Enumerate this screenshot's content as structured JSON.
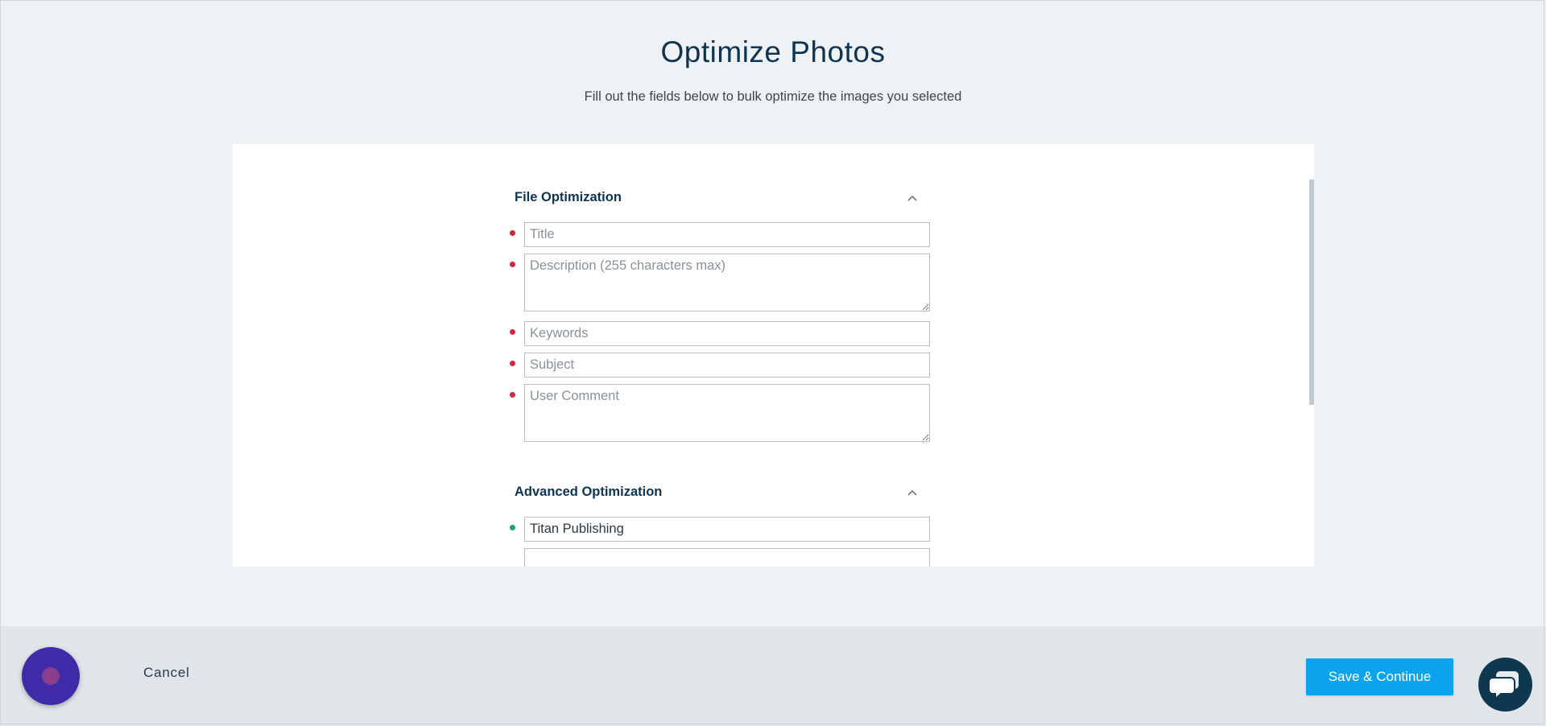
{
  "page": {
    "title": "Optimize Photos",
    "subtitle": "Fill out the fields below to bulk optimize the images you selected"
  },
  "sections": {
    "file_optimization": {
      "title": "File Optimization",
      "fields": {
        "title": {
          "placeholder": "Title",
          "value": ""
        },
        "description": {
          "placeholder": "Description (255 characters max)",
          "value": ""
        },
        "keywords": {
          "placeholder": "Keywords",
          "value": ""
        },
        "subject": {
          "placeholder": "Subject",
          "value": ""
        },
        "user_comment": {
          "placeholder": "User Comment",
          "value": ""
        }
      }
    },
    "advanced_optimization": {
      "title": "Advanced Optimization",
      "fields": {
        "author": {
          "placeholder": "",
          "value": "Titan Publishing"
        }
      }
    }
  },
  "footer": {
    "cancel_label": "Cancel",
    "save_label": "Save & Continue"
  },
  "colors": {
    "required_dot": "#d1283c",
    "filled_dot": "#1ea07a",
    "primary_button": "#0aa3ec",
    "heading": "#0f3450"
  },
  "icons": {
    "section_toggle": "chevron-up-icon",
    "assistant": "assistant-bubble-icon",
    "chat": "chat-icon"
  }
}
